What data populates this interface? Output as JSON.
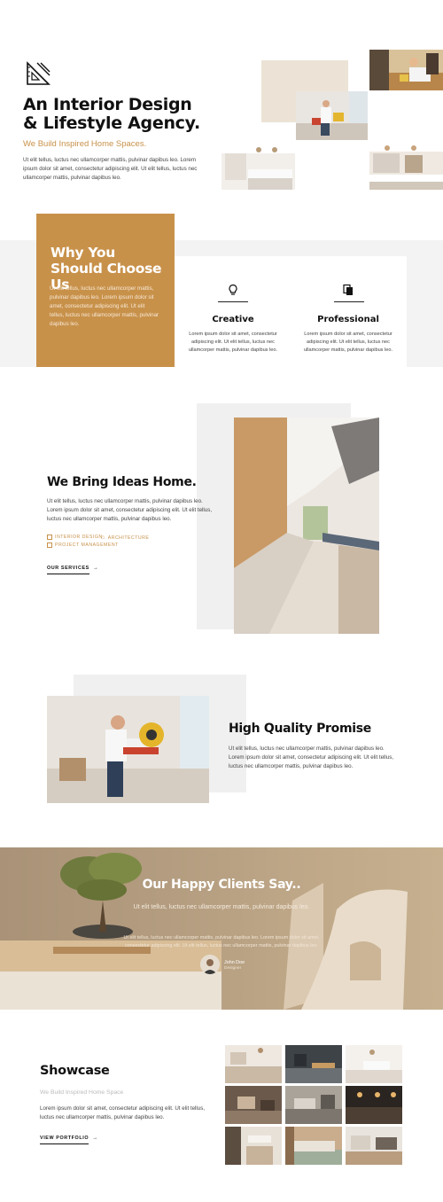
{
  "hero": {
    "title": "An Interior Design & Lifestyle Agency.",
    "subtitle": "We Build Inspired Home Spaces.",
    "text": "Ut elit tellus, luctus nec ullamcorper mattis, pulvinar dapibus leo. Lorem ipsum dolor sit amet, consectetur adipiscing elit. Ut elit tellus, luctus nec ullamcorper mattis, pulvinar dapibus leo.",
    "logo_icon": "ruler-triangle-icon"
  },
  "why": {
    "title": "Why You Should Choose Us",
    "text": "Ut elit tellus, luctus nec ullamcorper mattis, pulvinar dapibus leo. Lorem ipsum dolor sit amet, consectetur adipiscing elit. Ut elit tellus, luctus nec ullamcorper mattis, pulvinar dapibus leo.",
    "features": [
      {
        "icon": "lightbulb-icon",
        "title": "Creative",
        "text": "Lorem ipsum dolor sit amet, consectetur adipiscing elit. Ut elit tellus, luctus nec ullamcorper mattis, pulvinar dapibus leo."
      },
      {
        "icon": "documents-icon",
        "title": "Professional",
        "text": "Lorem ipsum dolor sit amet, consectetur adipiscing elit. Ut elit tellus, luctus nec ullamcorper mattis, pulvinar dapibus leo."
      }
    ]
  },
  "ideas": {
    "title": "We Bring Ideas Home.",
    "text": "Ut elit tellus, luctus nec ullamcorper mattis, pulvinar dapibus leo. Lorem ipsum dolor sit amet, consectetur adipiscing elit. Ut elit tellus, luctus nec ullamcorper mattis, pulvinar dapibus leo.",
    "tags": [
      "INTERIOR DESIGN",
      "ARCHITECTURE",
      "PROJECT MANAGEMENT"
    ],
    "button": "OUR SERVICES"
  },
  "quality": {
    "title": "High Quality Promise",
    "text": "Ut elit tellus, luctus nec ullamcorper mattis, pulvinar dapibus leo. Lorem ipsum dolor sit amet, consectetur adipiscing elit. Ut elit tellus, luctus nec ullamcorper mattis, pulvinar dapibus leo."
  },
  "testimonial": {
    "title": "Our Happy Clients Say..",
    "subtitle": "Ut elit tellus, luctus nec ullamcorper mattis, pulvinar dapibus leo.",
    "quote": "Ut elit tellus, luctus nec ullamcorper mattis, pulvinar dapibus leo. Lorem ipsum dolor sit amet, consectetur adipiscing elit. Ut elit tellus, luctus nec ullamcorper mattis, pulvinar dapibus leo.",
    "name": "John Doe",
    "role": "Designer"
  },
  "showcase": {
    "title": "Showcase",
    "subtitle": "We Build Inspired Home Space",
    "text": "Lorem ipsum dolor sit amet, consectetur adipiscing elit. Ut elit tellus, luctus nec ullamcorper mattis, pulvinar dapibus leo.",
    "button": "VIEW PORTFOLIO"
  },
  "colors": {
    "accent": "#c8914a",
    "band": "#f3f3f3",
    "text": "#111111"
  }
}
